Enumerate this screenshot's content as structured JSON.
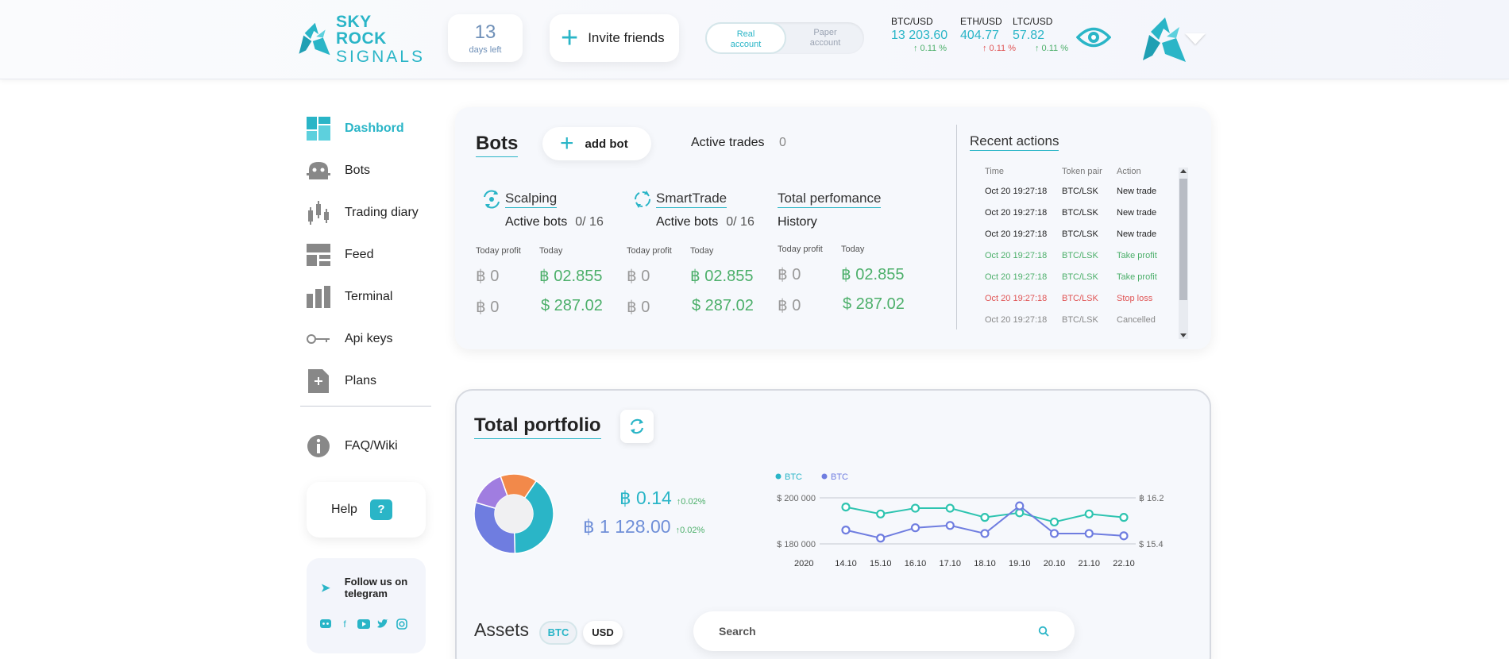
{
  "header": {
    "logo_line1": "SKY ROCK",
    "logo_line2": "SIGNALS",
    "days_num": "13",
    "days_label": "days left",
    "invite_label": "Invite friends",
    "account": {
      "real_l1": "Real",
      "real_l2": "account",
      "paper_l1": "Paper",
      "paper_l2": "account",
      "selected": "Real account"
    },
    "tickers": [
      {
        "pair": "BTC/USD",
        "price": "13 203.60",
        "change": "↑ 0.11 %",
        "dir": "up"
      },
      {
        "pair": "ETH/USD",
        "price": "404.77",
        "change": "↑ 0.11 %",
        "dir": "down"
      },
      {
        "pair": "LTC/USD",
        "price": "57.82",
        "change": "↑ 0.11 %",
        "dir": "up"
      }
    ]
  },
  "sidebar": {
    "items": [
      {
        "label": "Dashbord",
        "icon": "dashboard-icon",
        "active": true
      },
      {
        "label": "Bots",
        "icon": "bot-icon"
      },
      {
        "label": "Trading diary",
        "icon": "candlestick-icon"
      },
      {
        "label": "Feed",
        "icon": "feed-icon"
      },
      {
        "label": "Terminal",
        "icon": "bar-chart-icon"
      },
      {
        "label": "Api keys",
        "icon": "key-icon"
      },
      {
        "label": "Plans",
        "icon": "plans-icon"
      }
    ],
    "faq": "FAQ/Wiki",
    "help": "Help",
    "help_icon": "?",
    "telegram_l1": "Follow us on",
    "telegram_l2": "telegram",
    "socials": [
      "discord-icon",
      "facebook-icon",
      "youtube-icon",
      "twitter-icon",
      "instagram-icon"
    ]
  },
  "bots": {
    "title": "Bots",
    "add_label": "add bot",
    "active_trades_label": "Active trades",
    "active_trades_value": "0",
    "columns": [
      {
        "name": "Scalping",
        "sub": "Active bots",
        "count": "0/ 16",
        "h1": "Today profit",
        "h2": "Today",
        "btc_a": "฿ 0",
        "btc_b": "฿ 02.855",
        "usd_a": "฿ 0",
        "usd_b": "$ 287.02"
      },
      {
        "name": "SmartTrade",
        "sub": "Active bots",
        "count": "0/ 16",
        "h1": "Today profit",
        "h2": "Today",
        "btc_a": "฿ 0",
        "btc_b": "฿ 02.855",
        "usd_a": "฿ 0",
        "usd_b": "$ 287.02"
      },
      {
        "name": "Total perfomance",
        "sub": "History",
        "count": "",
        "h1": "Today profit",
        "h2": "Today",
        "btc_a": "฿ 0",
        "btc_b": "฿ 02.855",
        "usd_a": "฿ 0",
        "usd_b": "$ 287.02"
      }
    ],
    "recent": {
      "title": "Recent actions",
      "headers": [
        "Time",
        "Token pair",
        "Action"
      ],
      "rows": [
        {
          "time": "Oct 20 19:27:18",
          "pair": "BTC/LSK",
          "action": "New trade",
          "tone": ""
        },
        {
          "time": "Oct 20 19:27:18",
          "pair": "BTC/LSK",
          "action": "New trade",
          "tone": ""
        },
        {
          "time": "Oct 20 19:27:18",
          "pair": "BTC/LSK",
          "action": "New trade",
          "tone": ""
        },
        {
          "time": "Oct 20 19:27:18",
          "pair": "BTC/LSK",
          "action": "Take profit",
          "tone": "green"
        },
        {
          "time": "Oct 20 19:27:18",
          "pair": "BTC/LSK",
          "action": "Take profit",
          "tone": "green"
        },
        {
          "time": "Oct 20 19:27:18",
          "pair": "BTC/LSK",
          "action": "Stop loss",
          "tone": "red"
        },
        {
          "time": "Oct 20 19:27:18",
          "pair": "BTC/LSK",
          "action": "Cancelled",
          "tone": "grey"
        }
      ]
    }
  },
  "portfolio": {
    "title": "Total portfolio",
    "bal_btc": "฿ 0.14",
    "bal_btc_change": "↑0.02%",
    "bal_usd": "฿ 1 128.00",
    "bal_usd_change": "↑0.02%",
    "assets_label": "Assets",
    "toggle_btc": "BTC",
    "toggle_usd": "USD",
    "search_placeholder": "Search"
  },
  "colors": {
    "accent": "#2ab5c7",
    "teal": "#2ec4b0",
    "purple": "#6f7de0",
    "green": "#4caf6a",
    "red": "#e05454",
    "orange": "#f2894a"
  },
  "chart_data": [
    {
      "type": "pie",
      "donut": true,
      "slices": [
        {
          "value": 40,
          "color": "#2ab5c7"
        },
        {
          "value": 30,
          "color": "#6f7de0"
        },
        {
          "value": 15,
          "color": "#a07de0"
        },
        {
          "value": 15,
          "color": "#f2894a"
        }
      ]
    },
    {
      "type": "line",
      "legend": [
        "BTC",
        "BTC"
      ],
      "legend_colors": [
        "#2ab5c7",
        "#6f7de0"
      ],
      "x_label_prefix": "2020",
      "categories": [
        "14.10",
        "15.10",
        "16.10",
        "17.10",
        "18.10",
        "19.10",
        "20.10",
        "21.10",
        "22.10"
      ],
      "left_ticks": [
        "$ 200 000",
        "$ 180 000"
      ],
      "right_ticks": [
        "฿ 16.2",
        "$ 15.4"
      ],
      "ylim": [
        180000,
        200000
      ],
      "series": [
        {
          "name": "BTC",
          "color": "#2ec4b0",
          "values": [
            196000,
            193000,
            195500,
            195500,
            191500,
            193500,
            189500,
            193000,
            191500
          ]
        },
        {
          "name": "BTC",
          "color": "#6f7de0",
          "values": [
            186000,
            182500,
            187000,
            188000,
            184500,
            196500,
            184500,
            184500,
            183500
          ]
        }
      ]
    }
  ]
}
